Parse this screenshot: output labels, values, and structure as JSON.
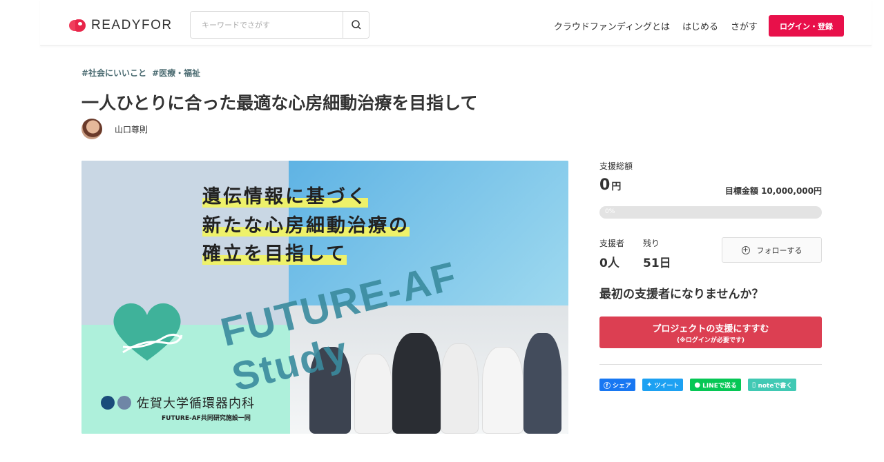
{
  "header": {
    "logo_text": "READYFOR",
    "search_placeholder": "キーワードでさがす",
    "nav": [
      "クラウドファンディングとは",
      "はじめる",
      "さがす"
    ],
    "login_label": "ログイン・登録"
  },
  "project": {
    "tags": [
      "#社会にいいこと",
      "#医療・福祉"
    ],
    "title": "一人ひとりに合った最適な心房細動治療を目指して",
    "owner": "山口尊則"
  },
  "hero": {
    "line1": "遺伝情報に基づく",
    "line2": "新たな心房細動治療の",
    "line3": "確立を目指して",
    "study": "FUTURE-AF Study",
    "dept": "佐賀大学循環器内科",
    "dept_sub": "FUTURE-AF共同研究施設一同"
  },
  "stats": {
    "total_label": "支援総額",
    "amount": "0",
    "yen": "円",
    "goal": "目標金額 10,000,000円",
    "progress_text": "0%",
    "progress": 0,
    "supporters_label": "支援者",
    "supporters": "0人",
    "remaining_label": "残り",
    "remaining": "51日",
    "follow_label": "フォローする",
    "first_prompt": "最初の支援者になりませんか？",
    "support_label": "プロジェクトの支援にすすむ",
    "support_sub": "(※ログインが必要です)"
  },
  "share": {
    "facebook": "シェア",
    "twitter": "ツイート",
    "line": "LINEで送る",
    "note": "noteで書く"
  },
  "colors": {
    "brand": "#e8104a",
    "support": "#dc3f52",
    "facebook": "#1877f2",
    "twitter": "#1da1f2",
    "line": "#06c755",
    "note": "#41c9b4"
  }
}
